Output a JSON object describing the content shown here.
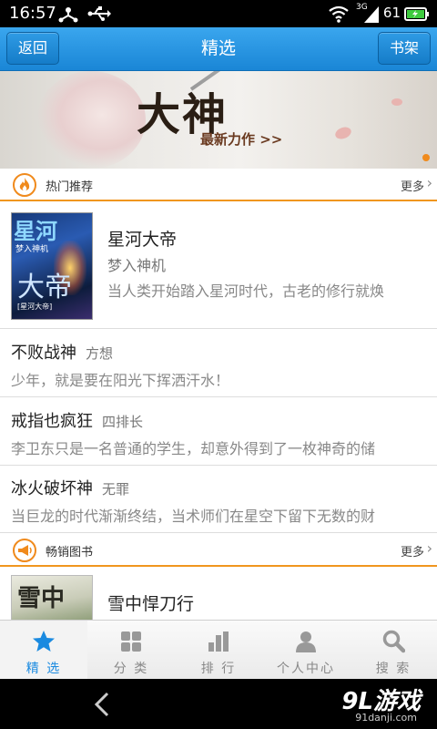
{
  "status_bar": {
    "time": "16:57",
    "net_type": "3G",
    "battery": "61"
  },
  "header": {
    "back_label": "返回",
    "title": "精选",
    "bookshelf_label": "书架"
  },
  "banner": {
    "title": "大神",
    "subtitle": "最新力作 >>"
  },
  "hot_section": {
    "title": "热门推荐",
    "more": "更多",
    "featured": {
      "cover_title": "星河",
      "cover_author": "梦入神机",
      "cover_big": "大帝",
      "cover_tag": "[星河大帝]",
      "title": "星河大帝",
      "author": "梦入神机",
      "desc": "当人类开始踏入星河时代，古老的修行就焕"
    },
    "items": [
      {
        "title": "不败战神",
        "author": "方想",
        "desc": "少年，就是要在阳光下挥洒汗水！"
      },
      {
        "title": "戒指也疯狂",
        "author": "四排长",
        "desc": "李卫东只是一名普通的学生，却意外得到了一枚神奇的储"
      },
      {
        "title": "冰火破坏神",
        "author": "无罪",
        "desc": "当巨龙的时代渐渐终结，当术师们在星空下留下无数的财"
      }
    ]
  },
  "bestseller_section": {
    "title": "畅销图书",
    "more": "更多",
    "first": {
      "cover_title": "雪中",
      "title": "雪中悍刀行"
    }
  },
  "tabs": [
    {
      "label": "精 选",
      "icon": "star-icon",
      "active": true
    },
    {
      "label": "分 类",
      "icon": "grid-icon",
      "active": false
    },
    {
      "label": "排 行",
      "icon": "bar-chart-icon",
      "active": false
    },
    {
      "label": "个人中心",
      "icon": "person-icon",
      "active": false
    },
    {
      "label": "搜 索",
      "icon": "search-icon",
      "active": false
    }
  ],
  "watermark": {
    "brand": "9L游戏",
    "site": "91danji.com"
  },
  "colors": {
    "header": "#1a86d6",
    "accent": "#f0961f",
    "active_tab": "#1a8ae0"
  }
}
